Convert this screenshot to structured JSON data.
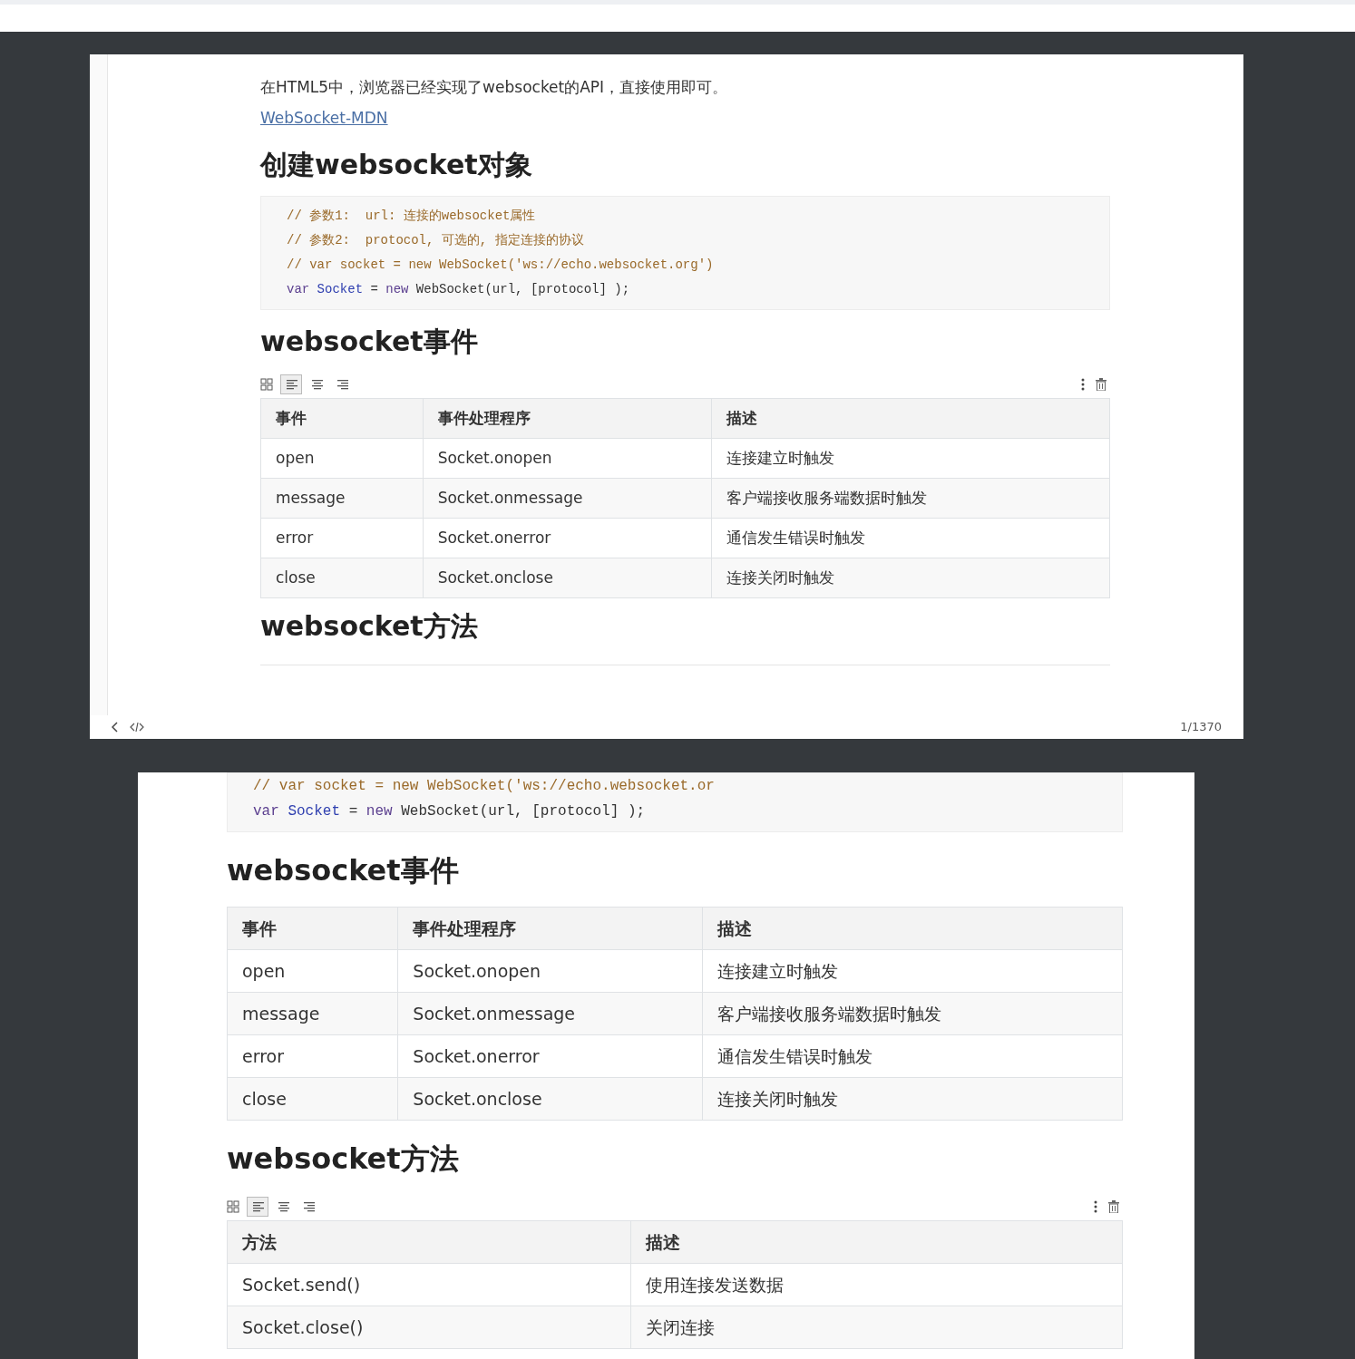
{
  "frames": [
    {
      "blocks": [
        {
          "kind": "paragraph",
          "text": "在HTML5中，浏览器已经实现了websocket的API，直接使用即可。"
        },
        {
          "kind": "link",
          "text": "WebSocket-MDN"
        },
        {
          "kind": "heading",
          "text": "创建websocket对象"
        },
        {
          "kind": "code",
          "lines": [
            [
              {
                "kind": "comment",
                "text": "// 参数1:  url: 连接的websocket属性"
              }
            ],
            [
              {
                "kind": "comment",
                "text": "// 参数2:  protocol, 可选的, 指定连接的协议"
              }
            ],
            [
              {
                "kind": "comment",
                "text": "// var socket = new WebSocket('ws://echo.websocket.org')"
              }
            ],
            [
              {
                "kind": "keyword",
                "text": "var"
              },
              {
                "kind": "variable",
                "text": "Socket"
              },
              {
                "kind": "plain",
                "text": "="
              },
              {
                "kind": "keyword",
                "text": "new"
              },
              {
                "kind": "plain",
                "text": "WebSocket(url, [protocol] );"
              }
            ]
          ]
        },
        {
          "kind": "heading",
          "text": "websocket事件"
        },
        {
          "kind": "table",
          "toolbar": {
            "align": [
              {
                "kind": "left",
                "selected": true
              },
              {
                "kind": "center",
                "selected": false
              },
              {
                "kind": "right",
                "selected": false
              }
            ]
          },
          "columns": [
            "事件",
            "事件处理程序",
            "描述"
          ],
          "rows": [
            [
              "open",
              "Socket.onopen",
              "连接建立时触发"
            ],
            [
              "message",
              "Socket.onmessage",
              "客户端接收服务端数据时触发"
            ],
            [
              "error",
              "Socket.onerror",
              "通信发生错误时触发"
            ],
            [
              "close",
              "Socket.onclose",
              "连接关闭时触发"
            ]
          ]
        },
        {
          "kind": "heading",
          "text": "websocket方法"
        },
        {
          "kind": "rule"
        }
      ],
      "footer": {
        "page": "1/1370"
      }
    },
    {
      "blocks": [
        {
          "kind": "code",
          "lines": [
            [
              {
                "kind": "comment",
                "text": "// var socket = new WebSocket('ws://echo.websocket.or"
              }
            ],
            [
              {
                "kind": "keyword",
                "text": "var"
              },
              {
                "kind": "variable",
                "text": "Socket"
              },
              {
                "kind": "plain",
                "text": "="
              },
              {
                "kind": "keyword",
                "text": "new"
              },
              {
                "kind": "plain",
                "text": "WebSocket(url, [protocol] );"
              }
            ]
          ]
        },
        {
          "kind": "heading",
          "text": "websocket事件"
        },
        {
          "kind": "table",
          "columns": [
            "事件",
            "事件处理程序",
            "描述"
          ],
          "rows": [
            [
              "open",
              "Socket.onopen",
              "连接建立时触发"
            ],
            [
              "message",
              "Socket.onmessage",
              "客户端接收服务端数据时触发"
            ],
            [
              "error",
              "Socket.onerror",
              "通信发生错误时触发"
            ],
            [
              "close",
              "Socket.onclose",
              "连接关闭时触发"
            ]
          ]
        },
        {
          "kind": "heading",
          "text": "websocket方法"
        },
        {
          "kind": "table",
          "toolbar": {
            "align": [
              {
                "kind": "left",
                "selected": true
              },
              {
                "kind": "center",
                "selected": false
              },
              {
                "kind": "right",
                "selected": false
              }
            ]
          },
          "columns": [
            "方法",
            "描述"
          ],
          "rows": [
            [
              "Socket.send()",
              "使用连接发送数据"
            ],
            [
              "Socket.close()",
              "关闭连接"
            ]
          ]
        }
      ]
    }
  ]
}
